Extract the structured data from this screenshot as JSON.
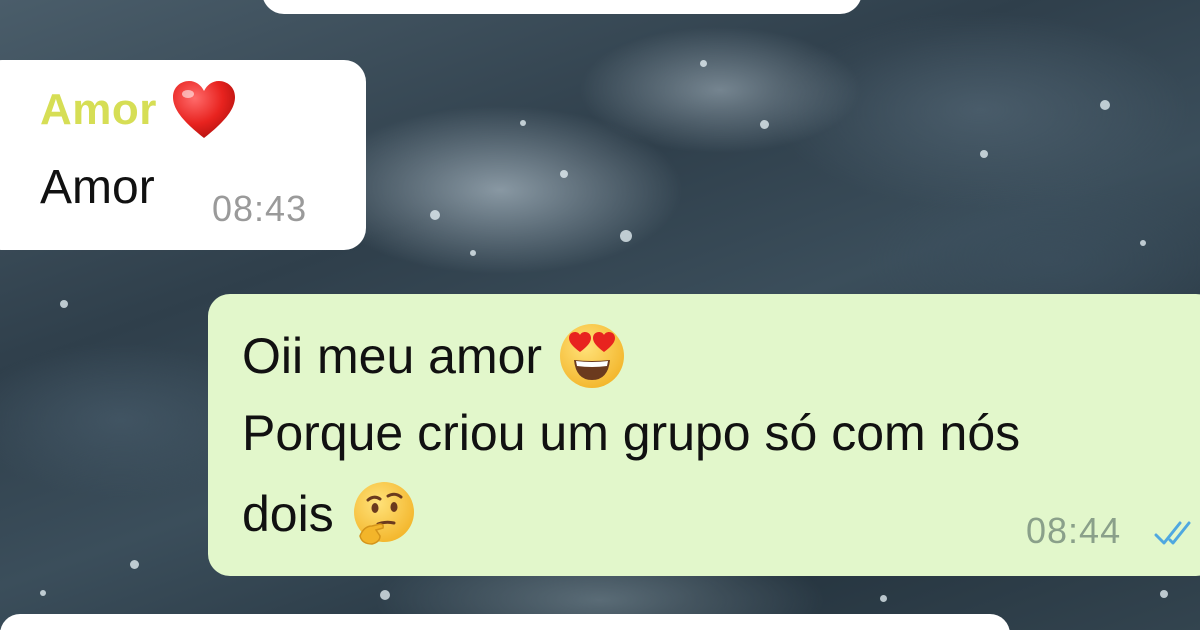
{
  "chat": {
    "messages": [
      {
        "direction": "incoming",
        "sender": "Amor",
        "sender_icon": "red-heart-icon",
        "text": "Amor",
        "time": "08:43"
      },
      {
        "direction": "outgoing",
        "lines": [
          {
            "text": "Oii meu amor",
            "emoji": "heart-eyes-emoji-icon"
          },
          {
            "text": "Porque criou um grupo só com nós"
          },
          {
            "text": "dois",
            "emoji": "thinking-face-emoji-icon"
          }
        ],
        "time": "08:44",
        "status_icon": "double-check-read-icon"
      }
    ]
  },
  "colors": {
    "incoming_bubble": "#ffffff",
    "outgoing_bubble": "#e2f7cb",
    "sender_name": "#d6de55",
    "timestamp": "#9a9a9a",
    "read_ticks": "#4fa8e0"
  }
}
